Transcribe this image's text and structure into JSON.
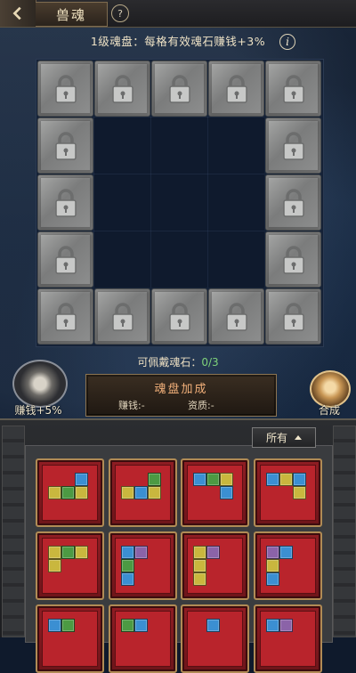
{
  "header": {
    "title": "兽魂",
    "help_glyph": "?"
  },
  "info": {
    "text": "1级魂盘：每格有效魂石赚钱+3%",
    "icon_glyph": "i"
  },
  "capacity": {
    "label": "可佩戴魂石：",
    "count": "0/3"
  },
  "left_button": {
    "label": "赚钱+5%"
  },
  "right_button": {
    "label": "合成"
  },
  "bonus": {
    "title": "魂盘加成",
    "earn": "赚钱:-",
    "aptitude": "资质:-"
  },
  "filter": {
    "selected": "所有"
  },
  "colors": {
    "yellow": "#c9b73e",
    "blue": "#3b8fd2",
    "green": "#4c9a43",
    "purple": "#8b63a8",
    "card_red": "#b9242c"
  },
  "icons": [
    "back-arrow-icon",
    "help-icon",
    "info-icon",
    "lock-icon",
    "dropdown-arrow-icon"
  ]
}
